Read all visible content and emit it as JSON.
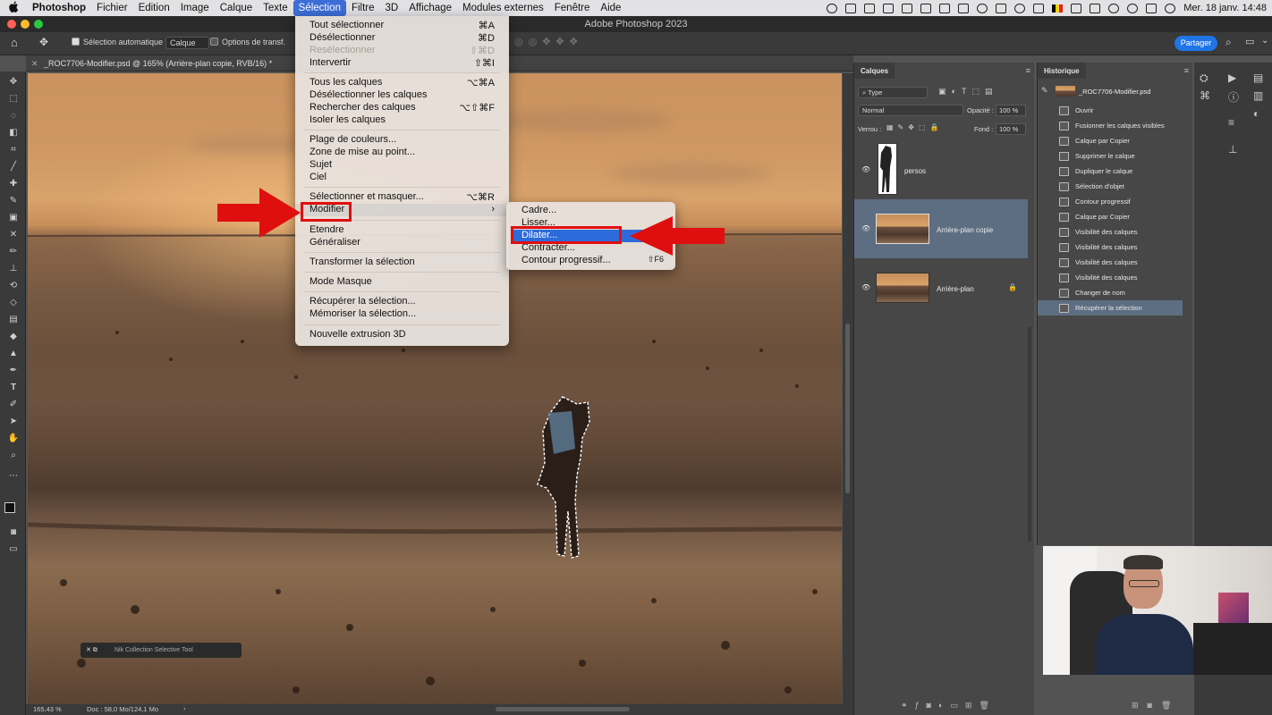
{
  "menubar": {
    "apple": "",
    "items": [
      "Photoshop",
      "Fichier",
      "Edition",
      "Image",
      "Calque",
      "Texte",
      "Sélection",
      "Filtre",
      "3D",
      "Affichage",
      "Modules externes",
      "Fenêtre",
      "Aide"
    ],
    "datetime": "Mer. 18 janv.  14:48"
  },
  "window": {
    "title": "Adobe Photoshop 2023"
  },
  "options": {
    "auto_select_label": "Sélection automatique :",
    "auto_select_value": "Calque",
    "transform_label": "Options de transf.",
    "share_label": "Partager"
  },
  "document": {
    "tab_title": "_ROC7706-Modifier.psd @ 165% (Arrière-plan copie, RVB/16) *",
    "zoom": "165,43 %",
    "doc_info": "Doc : 58,0 Mo/124,1 Mo",
    "nik_label": "Nik Collection Selective Tool"
  },
  "selection_menu": {
    "items": [
      {
        "label": "Tout sélectionner",
        "shortcut": "⌘A",
        "disabled": false
      },
      {
        "label": "Désélectionner",
        "shortcut": "⌘D",
        "disabled": false
      },
      {
        "label": "Resélectionner",
        "shortcut": "⇧⌘D",
        "disabled": true
      },
      {
        "label": "Intervertir",
        "shortcut": "⇧⌘I",
        "disabled": false
      },
      {
        "label": "Tous les calques",
        "shortcut": "⌥⌘A",
        "disabled": false
      },
      {
        "label": "Désélectionner les calques",
        "shortcut": "",
        "disabled": false
      },
      {
        "label": "Rechercher des calques",
        "shortcut": "⌥⇧⌘F",
        "disabled": false
      },
      {
        "label": "Isoler les calques",
        "shortcut": "",
        "disabled": false
      },
      {
        "label": "Plage de couleurs...",
        "shortcut": "",
        "disabled": false
      },
      {
        "label": "Zone de mise au point...",
        "shortcut": "",
        "disabled": false
      },
      {
        "label": "Sujet",
        "shortcut": "",
        "disabled": false
      },
      {
        "label": "Ciel",
        "shortcut": "",
        "disabled": false
      },
      {
        "label": "Sélectionner et masquer...",
        "shortcut": "⌥⌘R",
        "disabled": false
      },
      {
        "label": "Modifier",
        "shortcut": "›",
        "disabled": false
      },
      {
        "label": "Etendre",
        "shortcut": "",
        "disabled": false
      },
      {
        "label": "Généraliser",
        "shortcut": "",
        "disabled": false
      },
      {
        "label": "Transformer la sélection",
        "shortcut": "",
        "disabled": false
      },
      {
        "label": "Mode Masque",
        "shortcut": "",
        "disabled": false
      },
      {
        "label": "Récupérer la sélection...",
        "shortcut": "",
        "disabled": false
      },
      {
        "label": "Mémoriser la sélection...",
        "shortcut": "",
        "disabled": false
      },
      {
        "label": "Nouvelle extrusion 3D",
        "shortcut": "",
        "disabled": false
      }
    ]
  },
  "modify_submenu": {
    "items": [
      {
        "label": "Cadre...",
        "shortcut": ""
      },
      {
        "label": "Lisser...",
        "shortcut": ""
      },
      {
        "label": "Dilater...",
        "shortcut": ""
      },
      {
        "label": "Contracter...",
        "shortcut": ""
      },
      {
        "label": "Contour progressif...",
        "shortcut": "⇧F6"
      }
    ]
  },
  "layers_panel": {
    "title": "Calques",
    "filter": "Type",
    "blend_mode": "Normal",
    "opacity_label": "Opacité :",
    "opacity": "100 %",
    "lock_label": "Verrou :",
    "fill_label": "Fond :",
    "fill": "100 %",
    "layers": [
      {
        "name": "persos",
        "selected": false
      },
      {
        "name": "Arrière-plan copie",
        "selected": true
      },
      {
        "name": "Arrière-plan",
        "selected": false
      }
    ]
  },
  "history_panel": {
    "title": "Historique",
    "snapshot": "_ROC7706-Modifier.psd",
    "steps": [
      "Ouvrir",
      "Fusionner les calques visibles",
      "Calque par Copier",
      "Supprimer le calque",
      "Dupliquer le calque",
      "Sélection d'objet",
      "Contour progressif",
      "Calque par Copier",
      "Visibilité des calques",
      "Visibilité des calques",
      "Visibilité des calques",
      "Visibilité des calques",
      "Changer de nom",
      "Récupérer la sélection"
    ],
    "active_step": 13
  },
  "colors": {
    "accent": "#2d6bdb",
    "annotation_red": "#e00f0f",
    "panel": "#474747"
  }
}
